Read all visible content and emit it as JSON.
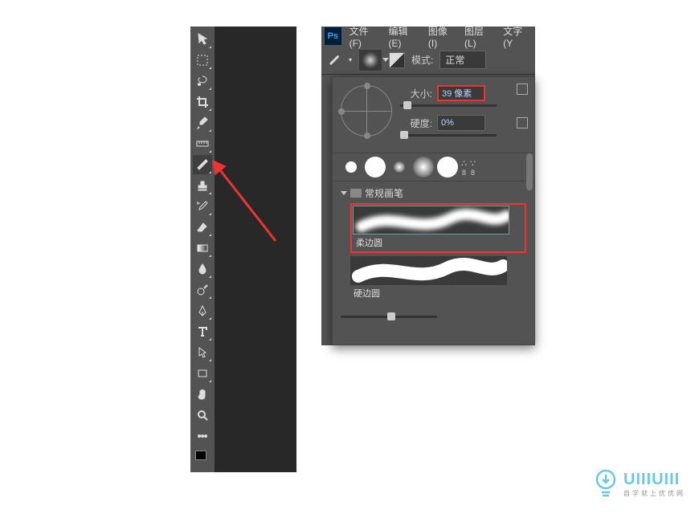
{
  "toolbar": {
    "tools": [
      "move",
      "marquee",
      "lasso",
      "crop",
      "eyedropper",
      "ruler",
      "brush",
      "stamp",
      "history",
      "eraser",
      "gradient",
      "blur",
      "pen-alt",
      "pen",
      "type",
      "path-select",
      "rectangle",
      "hand",
      "zoom",
      "more",
      "color-swatch"
    ]
  },
  "menubar": {
    "items": [
      {
        "label": "文件(F)"
      },
      {
        "label": "编辑(E)"
      },
      {
        "label": "图像(I)"
      },
      {
        "label": "图层(L)"
      },
      {
        "label": "文字(Y"
      }
    ]
  },
  "optionbar": {
    "mode_label": "模式:",
    "mode_value": "正常"
  },
  "brush_popup": {
    "size_label": "大小:",
    "size_value": "39 像素",
    "hardness_label": "硬度:",
    "hardness_value": "0%",
    "preset_eights": [
      "8",
      "8"
    ],
    "folder_label": "常规画笔",
    "brushes": [
      {
        "name": "柔边圆"
      },
      {
        "name": "硬边圆"
      }
    ]
  },
  "watermark": {
    "brand": "UIIIUIII",
    "sub": "自学就上优优网"
  }
}
